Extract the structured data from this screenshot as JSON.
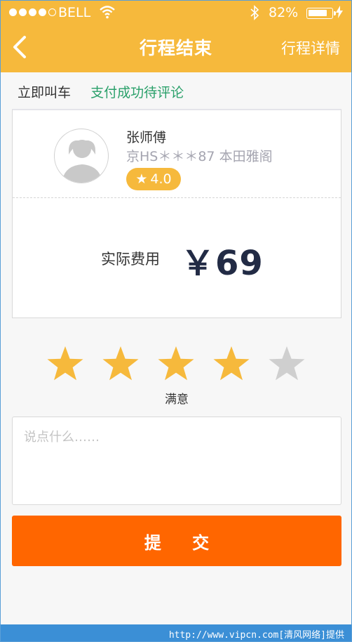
{
  "status_bar": {
    "carrier": "BELL",
    "battery_percent": "82%",
    "battery_level": 0.82,
    "signal_bars_filled": 4,
    "signal_bars_total": 5
  },
  "nav": {
    "title": "行程结束",
    "right_link": "行程详情",
    "back_icon": "chevron-left-icon"
  },
  "progress": {
    "step1": "立即叫车",
    "step2": "支付成功待评论"
  },
  "driver": {
    "name": "张师傅",
    "plate_and_car": "京HS＊＊＊87  本田雅阁",
    "rating": "4.0",
    "rating_icon": "star-icon"
  },
  "fee": {
    "label": "实际费用",
    "amount": "￥69"
  },
  "review": {
    "rating_selected": 4,
    "rating_max": 5,
    "rating_text": "满意",
    "comment_placeholder": "说点什么……",
    "comment_value": ""
  },
  "submit_label": "提 交",
  "footer": {
    "watermark": "http://www.vipcn.com[清风网络]提供"
  },
  "colors": {
    "brand_yellow": "#f6b93c",
    "submit_orange": "#ff6600",
    "success_green": "#2aa06a",
    "star_active": "#f6b93c",
    "star_inactive": "#cfcfcf"
  }
}
